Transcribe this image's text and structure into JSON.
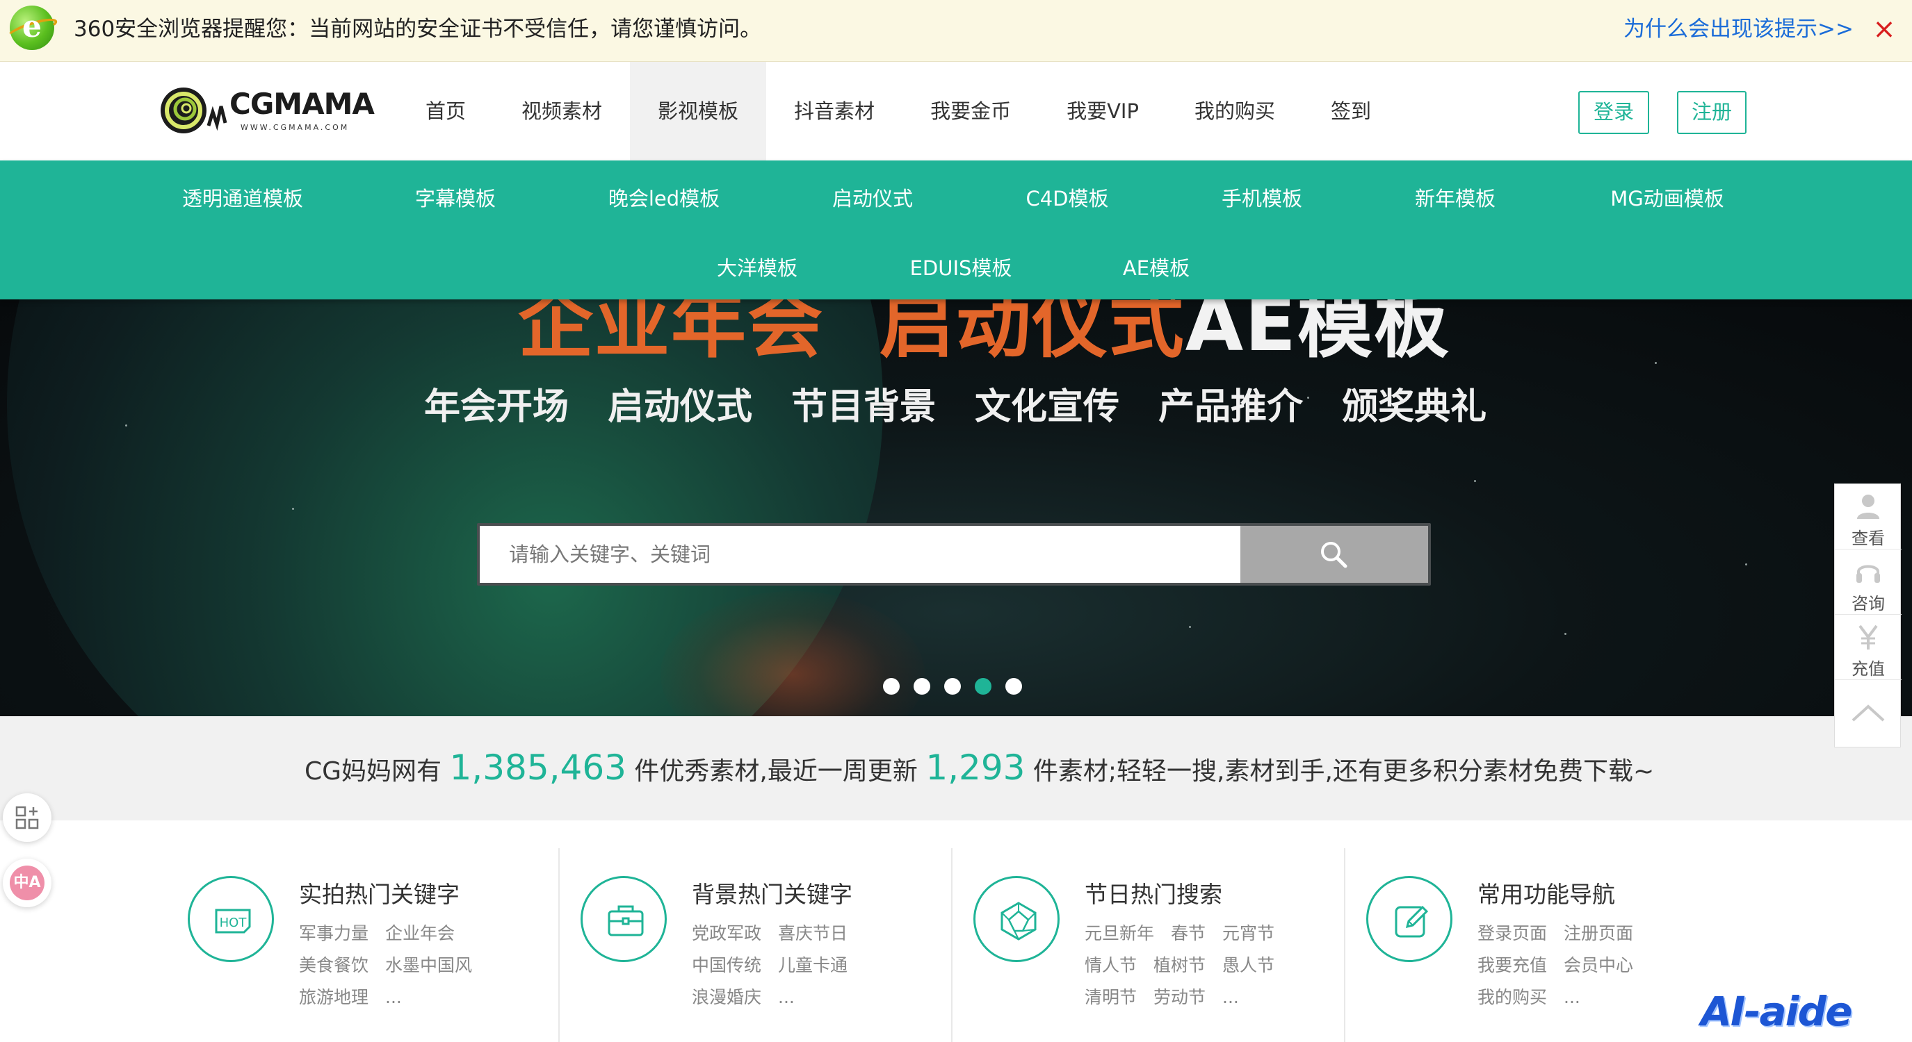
{
  "warning_bar": {
    "message": "360安全浏览器提醒您：当前网站的安全证书不受信任，请您谨慎访问。",
    "link": "为什么会出现该提示>>",
    "close": "×"
  },
  "header": {
    "logo_text": "CGMAMA",
    "logo_url": "WWW.CGMAMA.COM",
    "nav": [
      "首页",
      "视频素材",
      "影视模板",
      "抖音素材",
      "我要金币",
      "我要VIP",
      "我的购买",
      "签到"
    ],
    "active_nav": "影视模板",
    "login": "登录",
    "register": "注册"
  },
  "categories": {
    "row1": [
      "透明通道模板",
      "字幕模板",
      "晚会led模板",
      "启动仪式",
      "C4D模板",
      "手机模板",
      "新年模板",
      "MG动画模板"
    ],
    "row2": [
      "大洋模板",
      "EDUIS模板",
      "AE模板"
    ]
  },
  "banner": {
    "headline_part1": "企业年会",
    "headline_part2": "启动仪式",
    "headline_part3": "AE模板",
    "subtitles": [
      "年会开场",
      "启动仪式",
      "节目背景",
      "文化宣传",
      "产品推介",
      "颁奖典礼"
    ],
    "search_placeholder": "请输入关键字、关键词",
    "slides_count": 5,
    "active_slide": 4
  },
  "stats": {
    "prefix": "CG妈妈网有",
    "total": "1,385,463",
    "middle": "件优秀素材,最近一周更新",
    "weekly": "1,293",
    "suffix": "件素材;轻轻一搜,素材到手,还有更多积分素材免费下载~"
  },
  "cards": [
    {
      "title": "实拍热门关键字",
      "icon": "hot-icon",
      "links": [
        "军事力量",
        "企业年会",
        "美食餐饮",
        "水墨中国风",
        "旅游地理",
        "..."
      ]
    },
    {
      "title": "背景热门关键字",
      "icon": "briefcase-icon",
      "links": [
        "党政军政",
        "喜庆节日",
        "中国传统",
        "儿童卡通",
        "浪漫婚庆",
        "..."
      ]
    },
    {
      "title": "节日热门搜索",
      "icon": "polyhedron-icon",
      "links": [
        "元旦新年",
        "春节",
        "元宵节",
        "情人节",
        "植树节",
        "愚人节",
        "清明节",
        "劳动节",
        "..."
      ]
    },
    {
      "title": "常用功能导航",
      "icon": "edit-icon",
      "links": [
        "登录页面",
        "注册页面",
        "我要充值",
        "会员中心",
        "我的购买",
        "..."
      ]
    }
  ],
  "side_tools": {
    "view": "查看",
    "consult": "咨询",
    "recharge": "充值"
  },
  "float_widgets": {
    "translate": "中A"
  },
  "watermark": "AI-aide",
  "colors": {
    "brand_green": "#1fb497",
    "headline_orange": "#e3662a",
    "warning_bg": "#fbf8e3",
    "link_blue": "#1b6cd8"
  }
}
